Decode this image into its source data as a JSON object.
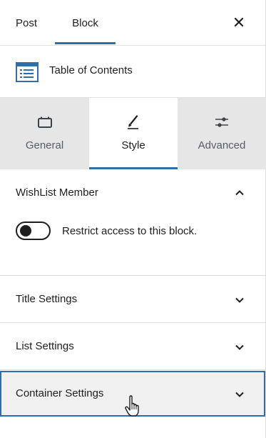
{
  "top_tabs": {
    "post_label": "Post",
    "block_label": "Block",
    "close_icon": "close-icon"
  },
  "block_card": {
    "title": "Table of Contents",
    "icon": "table-of-contents-icon"
  },
  "inspector_tabs": [
    {
      "label": "General",
      "icon": "general-icon"
    },
    {
      "label": "Style",
      "icon": "brush-icon",
      "active": true
    },
    {
      "label": "Advanced",
      "icon": "sliders-icon"
    }
  ],
  "sections": {
    "wishlist": {
      "title": "WishList Member",
      "expanded": true,
      "toggle_label": "Restrict access to this block.",
      "toggle_on": false
    },
    "title_settings": {
      "title": "Title Settings",
      "expanded": false
    },
    "list_settings": {
      "title": "List Settings",
      "expanded": false
    },
    "container_settings": {
      "title": "Container Settings",
      "expanded": false,
      "focused": true
    }
  },
  "colors": {
    "accent": "#2f6ea8",
    "tab_bg": "#e6e6e6",
    "focused_bg": "#f0f0f0",
    "text": "#1e1e1e"
  }
}
